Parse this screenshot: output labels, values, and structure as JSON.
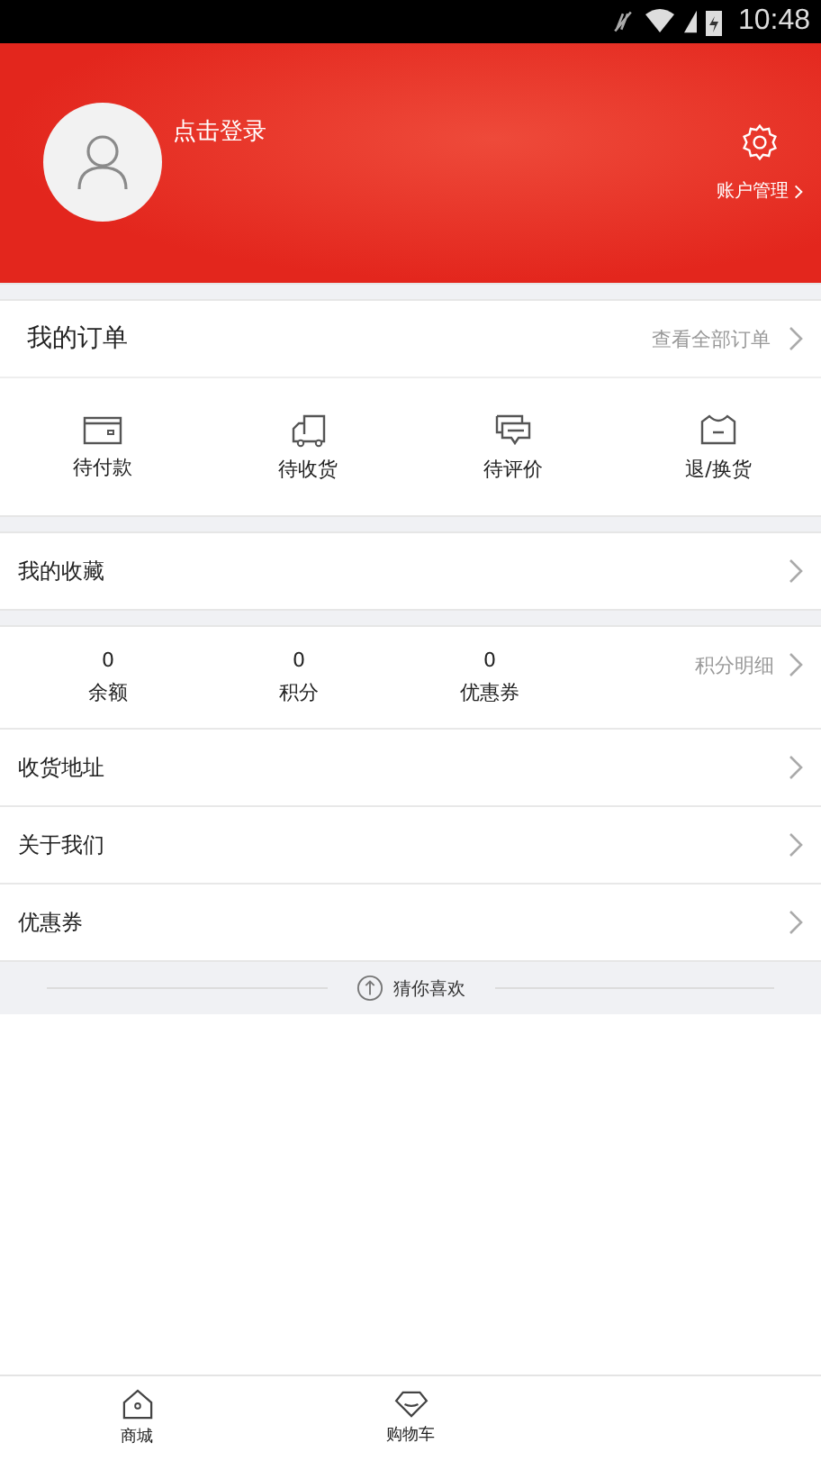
{
  "status_bar": {
    "time": "10:48"
  },
  "header": {
    "login_text": "点击登录",
    "account_label": "账户管理"
  },
  "orders": {
    "title": "我的订单",
    "view_all": "查看全部订单",
    "items": [
      {
        "label": "待付款",
        "kind": "wallet"
      },
      {
        "label": "待收货",
        "kind": "truck"
      },
      {
        "label": "待评价",
        "kind": "comment"
      },
      {
        "label": "退/换货",
        "kind": "shirt"
      }
    ]
  },
  "favorites": {
    "label": "我的收藏"
  },
  "stats": {
    "items": [
      {
        "value": "0",
        "label": "余额"
      },
      {
        "value": "0",
        "label": "积分"
      },
      {
        "value": "0",
        "label": "优惠券"
      }
    ],
    "detail_link": "积分明细"
  },
  "menu": [
    {
      "label": "收货地址"
    },
    {
      "label": "关于我们"
    },
    {
      "label": "优惠券"
    }
  ],
  "recommend": {
    "label": "猜你喜欢"
  },
  "bottom_nav": [
    {
      "label": "商城",
      "kind": "home"
    },
    {
      "label": "购物车",
      "kind": "diamond"
    }
  ]
}
